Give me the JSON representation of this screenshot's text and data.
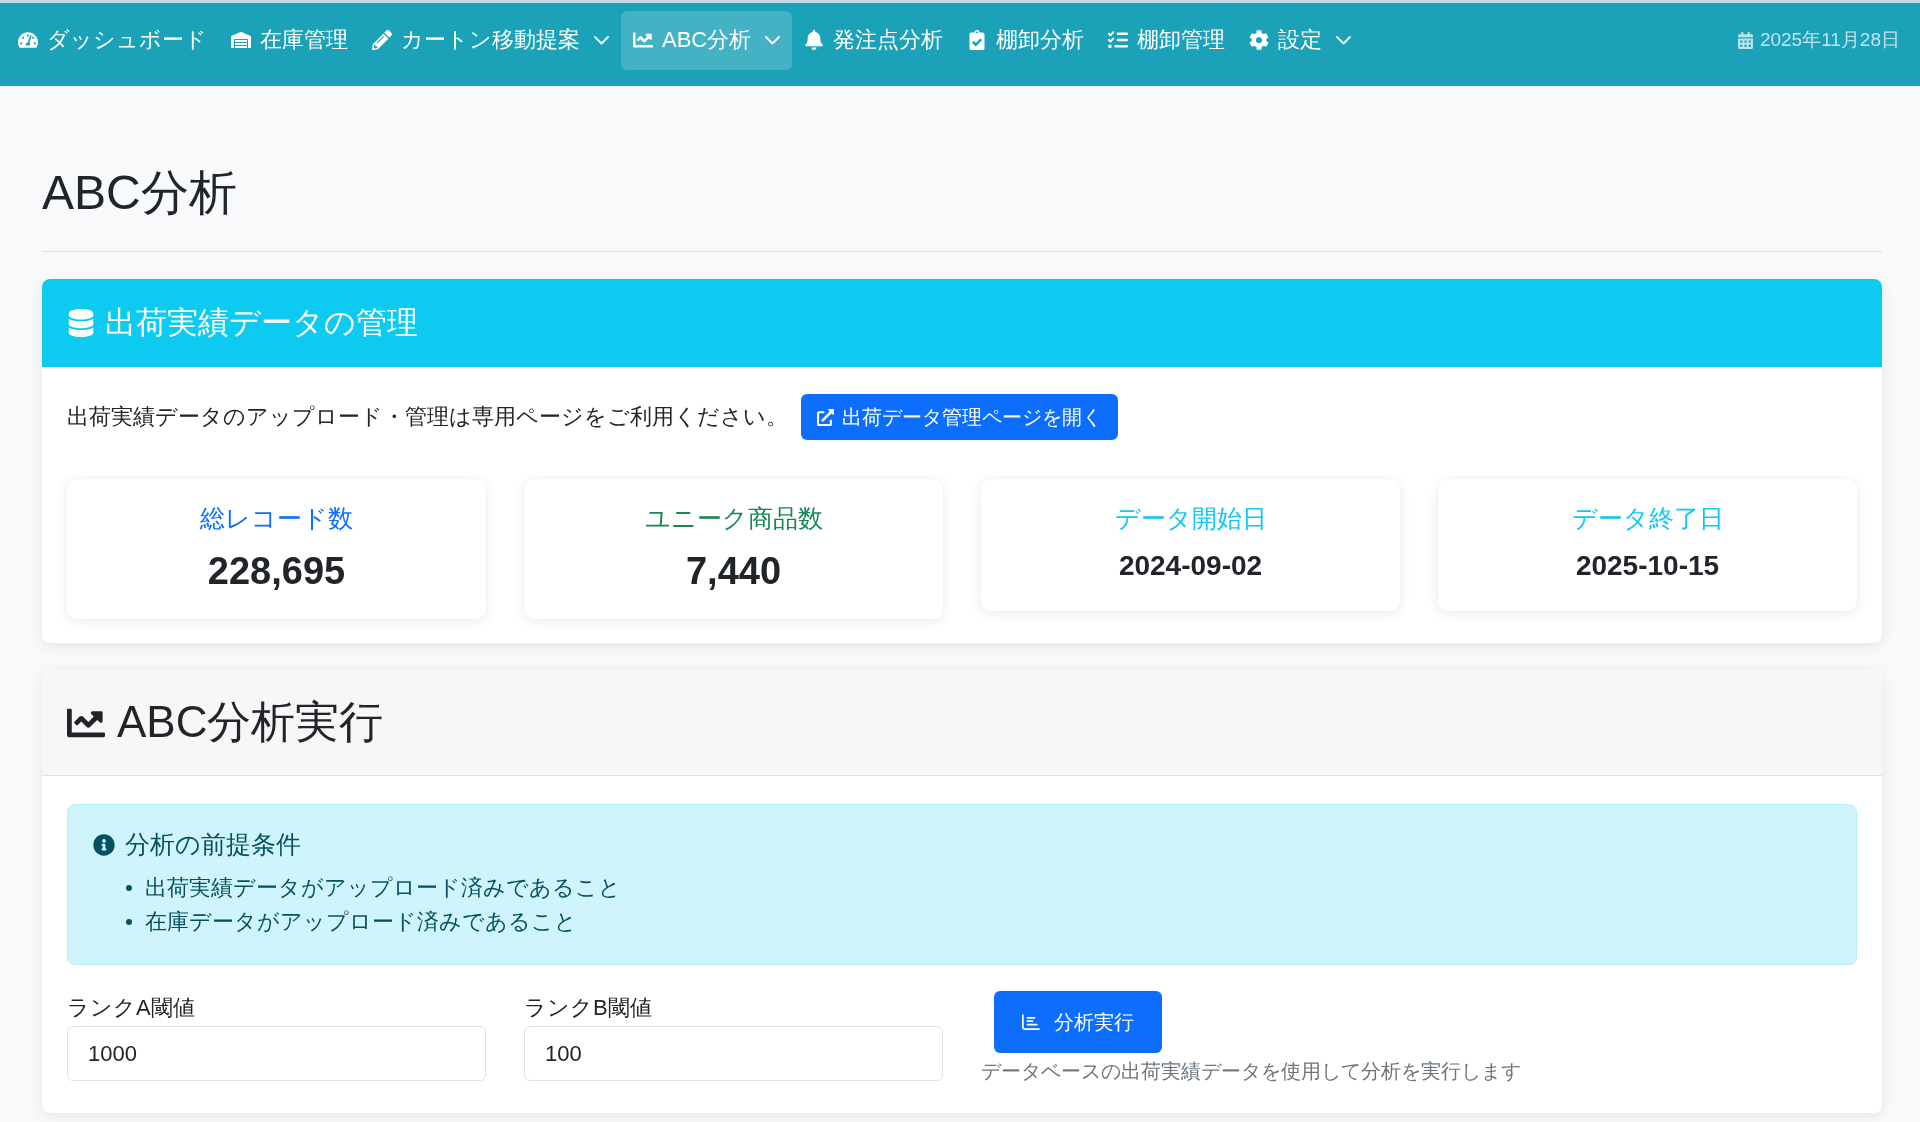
{
  "navbar": {
    "items": [
      {
        "label": "ダッシュボード",
        "dropdown": false,
        "selected": false
      },
      {
        "label": "在庫管理",
        "dropdown": false,
        "selected": false
      },
      {
        "label": "カートン移動提案",
        "dropdown": true,
        "selected": false
      },
      {
        "label": "ABC分析",
        "dropdown": true,
        "selected": true
      },
      {
        "label": "発注点分析",
        "dropdown": false,
        "selected": false
      },
      {
        "label": "棚卸分析",
        "dropdown": false,
        "selected": false
      },
      {
        "label": "棚卸管理",
        "dropdown": false,
        "selected": false
      },
      {
        "label": "設定",
        "dropdown": true,
        "selected": false
      }
    ],
    "date": "2025年11月28日"
  },
  "page_title": "ABC分析",
  "shipment_data_card": {
    "title": "出荷実績データの管理",
    "description": "出荷実績データのアップロード・管理は専用ページをご利用ください。",
    "button": "出荷データ管理ページを開く",
    "stats": [
      {
        "label": "総レコード数",
        "value": "228,695",
        "kind": "count",
        "color": "#0d6efd"
      },
      {
        "label": "ユニーク商品数",
        "value": "7,440",
        "kind": "count",
        "color": "#198754"
      },
      {
        "label": "データ開始日",
        "value": "2024-09-02",
        "kind": "date",
        "color": "#0dcaf0"
      },
      {
        "label": "データ終了日",
        "value": "2025-10-15",
        "kind": "date",
        "color": "#0dcaf0"
      }
    ]
  },
  "analysis_card": {
    "title": "ABC分析実行",
    "alert": {
      "title": "分析の前提条件",
      "items": [
        "出荷実績データがアップロード済みであること",
        "在庫データがアップロード済みであること"
      ]
    },
    "fields": [
      {
        "label": "ランクA閾値",
        "value": "1000"
      },
      {
        "label": "ランクB閾値",
        "value": "100"
      }
    ],
    "button": "分析実行",
    "help": "データベースの出荷実績データを使用して分析を実行します"
  }
}
